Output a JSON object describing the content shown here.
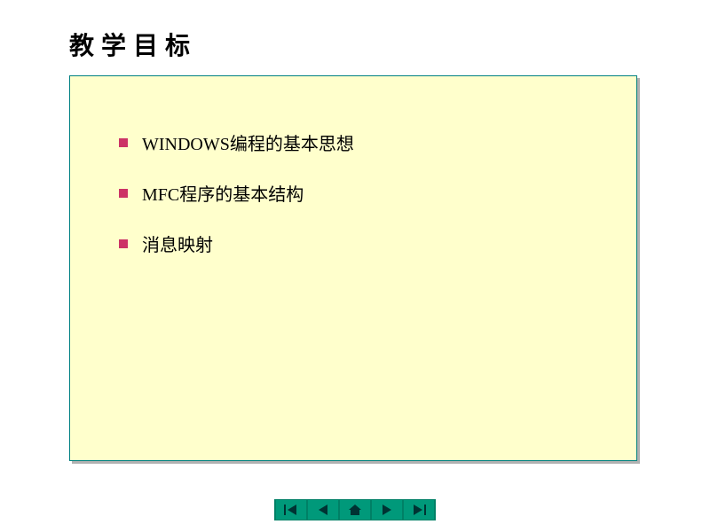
{
  "title": "教学目标",
  "bullets": [
    "WINDOWS编程的基本思想",
    "MFC程序的基本结构",
    "消息映射"
  ],
  "nav": {
    "first": "first",
    "prev": "prev",
    "home": "home",
    "next": "next",
    "last": "last"
  }
}
